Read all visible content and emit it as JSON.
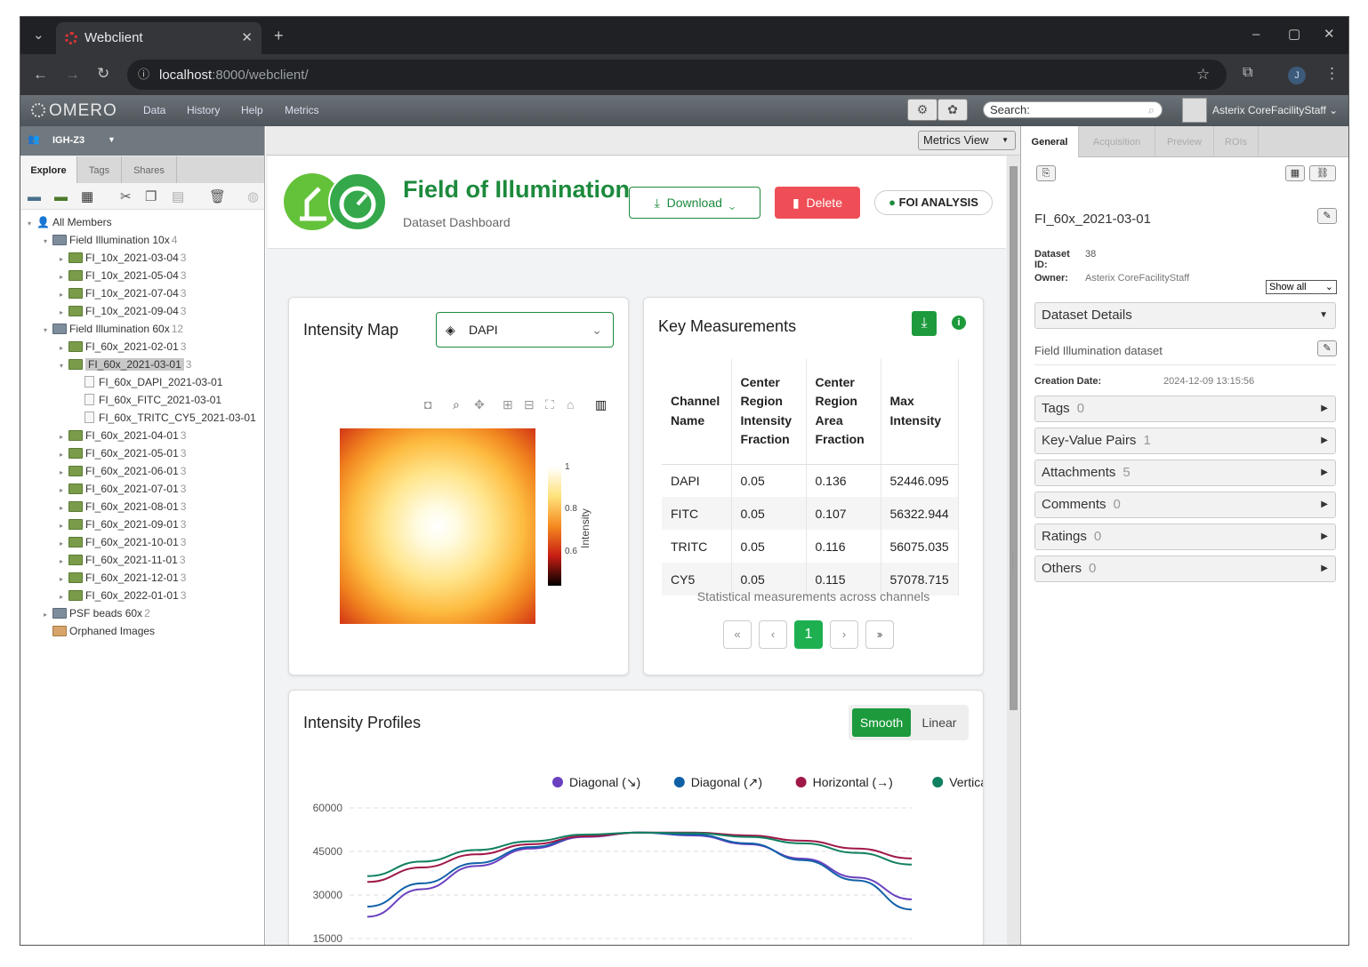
{
  "browser": {
    "tab_title": "Webclient",
    "url_host": "localhost",
    "url_path": ":8000/webclient/",
    "profile_initial": "J"
  },
  "omero": {
    "logo": "OMERO",
    "menu": [
      "Data",
      "History",
      "Help",
      "Metrics"
    ],
    "search_placeholder": "Search:",
    "user": "Asterix CoreFacilityStaff"
  },
  "left": {
    "group": "IGH-Z3",
    "tabs": [
      "Explore",
      "Tags",
      "Shares"
    ],
    "tree": [
      {
        "label": "All Members",
        "level": 0,
        "kind": "user",
        "count": ""
      },
      {
        "label": "Field Illumination 10x",
        "level": 1,
        "kind": "project",
        "count": "4"
      },
      {
        "label": "FI_10x_2021-03-04",
        "level": 2,
        "kind": "dataset",
        "count": "3"
      },
      {
        "label": "FI_10x_2021-05-04",
        "level": 2,
        "kind": "dataset",
        "count": "3"
      },
      {
        "label": "FI_10x_2021-07-04",
        "level": 2,
        "kind": "dataset",
        "count": "3"
      },
      {
        "label": "FI_10x_2021-09-04",
        "level": 2,
        "kind": "dataset",
        "count": "3"
      },
      {
        "label": "Field Illumination 60x",
        "level": 1,
        "kind": "project",
        "count": "12"
      },
      {
        "label": "FI_60x_2021-02-01",
        "level": 2,
        "kind": "dataset",
        "count": "3"
      },
      {
        "label": "FI_60x_2021-03-01",
        "level": 2,
        "kind": "dataset",
        "count": "3",
        "selected": true
      },
      {
        "label": "FI_60x_DAPI_2021-03-01",
        "level": 3,
        "kind": "image",
        "count": ""
      },
      {
        "label": "FI_60x_FITC_2021-03-01",
        "level": 3,
        "kind": "image",
        "count": ""
      },
      {
        "label": "FI_60x_TRITC_CY5_2021-03-01",
        "level": 3,
        "kind": "image",
        "count": ""
      },
      {
        "label": "FI_60x_2021-04-01",
        "level": 2,
        "kind": "dataset",
        "count": "3"
      },
      {
        "label": "FI_60x_2021-05-01",
        "level": 2,
        "kind": "dataset",
        "count": "3"
      },
      {
        "label": "FI_60x_2021-06-01",
        "level": 2,
        "kind": "dataset",
        "count": "3"
      },
      {
        "label": "FI_60x_2021-07-01",
        "level": 2,
        "kind": "dataset",
        "count": "3"
      },
      {
        "label": "FI_60x_2021-08-01",
        "level": 2,
        "kind": "dataset",
        "count": "3"
      },
      {
        "label": "FI_60x_2021-09-01",
        "level": 2,
        "kind": "dataset",
        "count": "3"
      },
      {
        "label": "FI_60x_2021-10-01",
        "level": 2,
        "kind": "dataset",
        "count": "3"
      },
      {
        "label": "FI_60x_2021-11-01",
        "level": 2,
        "kind": "dataset",
        "count": "3"
      },
      {
        "label": "FI_60x_2021-12-01",
        "level": 2,
        "kind": "dataset",
        "count": "3"
      },
      {
        "label": "FI_60x_2022-01-01",
        "level": 2,
        "kind": "dataset",
        "count": "3"
      },
      {
        "label": "PSF beads 60x",
        "level": 1,
        "kind": "project",
        "count": "2"
      },
      {
        "label": "Orphaned Images",
        "level": 1,
        "kind": "orphan",
        "count": ""
      }
    ]
  },
  "center": {
    "view_select": "Metrics View",
    "title": "Field of Illumination",
    "subtitle": "Dataset Dashboard",
    "download": "Download",
    "delete": "Delete",
    "badge": "FOI ANALYSIS",
    "intensity_map": {
      "title": "Intensity Map",
      "channel": "DAPI",
      "colorbar_label": "Intensity",
      "colorbar_ticks": [
        "1",
        "0.8",
        "0.6"
      ]
    },
    "key": {
      "title": "Key Measurements",
      "headers": [
        "Channel Name",
        "Center Region Intensity Fraction",
        "Center Region Area Fraction",
        "Max Intensity"
      ],
      "rows": [
        [
          "DAPI",
          "0.05",
          "0.136",
          "52446.095"
        ],
        [
          "FITC",
          "0.05",
          "0.107",
          "56322.944"
        ],
        [
          "TRITC",
          "0.05",
          "0.116",
          "56075.035"
        ],
        [
          "CY5",
          "0.05",
          "0.115",
          "57078.715"
        ]
      ],
      "caption": "Statistical measurements across channels",
      "page": "1"
    },
    "profiles": {
      "title": "Intensity Profiles",
      "smooth": "Smooth",
      "linear": "Linear"
    }
  },
  "chart_data": {
    "type": "line",
    "title": "",
    "ylim": [
      15000,
      60000
    ],
    "yticks": [
      "60000",
      "45000",
      "30000",
      "15000"
    ],
    "x": [
      0,
      0.1,
      0.2,
      0.3,
      0.4,
      0.5,
      0.6,
      0.7,
      0.8,
      0.9,
      1.0
    ],
    "series": [
      {
        "name": "Diagonal (↘)",
        "color": "#6a40c0",
        "values": [
          22500,
          32000,
          40000,
          46000,
          50000,
          51500,
          50500,
          47500,
          42500,
          36000,
          28500
        ]
      },
      {
        "name": "Diagonal (↗)",
        "color": "#1060a8",
        "values": [
          26000,
          34000,
          41000,
          46500,
          50300,
          51500,
          50800,
          47800,
          42000,
          35000,
          25000
        ]
      },
      {
        "name": "Horizontal (→)",
        "color": "#a01848",
        "values": [
          34500,
          39500,
          44000,
          47500,
          50200,
          51500,
          51500,
          50500,
          48700,
          46000,
          42600
        ]
      },
      {
        "name": "Vertical (↓)",
        "color": "#108060",
        "values": [
          36500,
          41500,
          45500,
          48500,
          50800,
          51500,
          51300,
          50000,
          47800,
          44500,
          40500
        ]
      }
    ]
  },
  "right": {
    "tabs": [
      "General",
      "Acquisition",
      "Preview",
      "ROIs"
    ],
    "name": "FI_60x_2021-03-01",
    "id_label": "Dataset ID:",
    "id": "38",
    "owner_label": "Owner:",
    "owner": "Asterix CoreFacilityStaff",
    "show": "Show all",
    "details": "Dataset Details",
    "description": "Field Illumination dataset",
    "date_label": "Creation Date:",
    "date": "2024-12-09 13:15:56",
    "sections": [
      {
        "label": "Tags",
        "count": "0"
      },
      {
        "label": "Key-Value Pairs",
        "count": "1"
      },
      {
        "label": "Attachments",
        "count": "5"
      },
      {
        "label": "Comments",
        "count": "0"
      },
      {
        "label": "Ratings",
        "count": "0"
      },
      {
        "label": "Others",
        "count": "0"
      }
    ]
  }
}
